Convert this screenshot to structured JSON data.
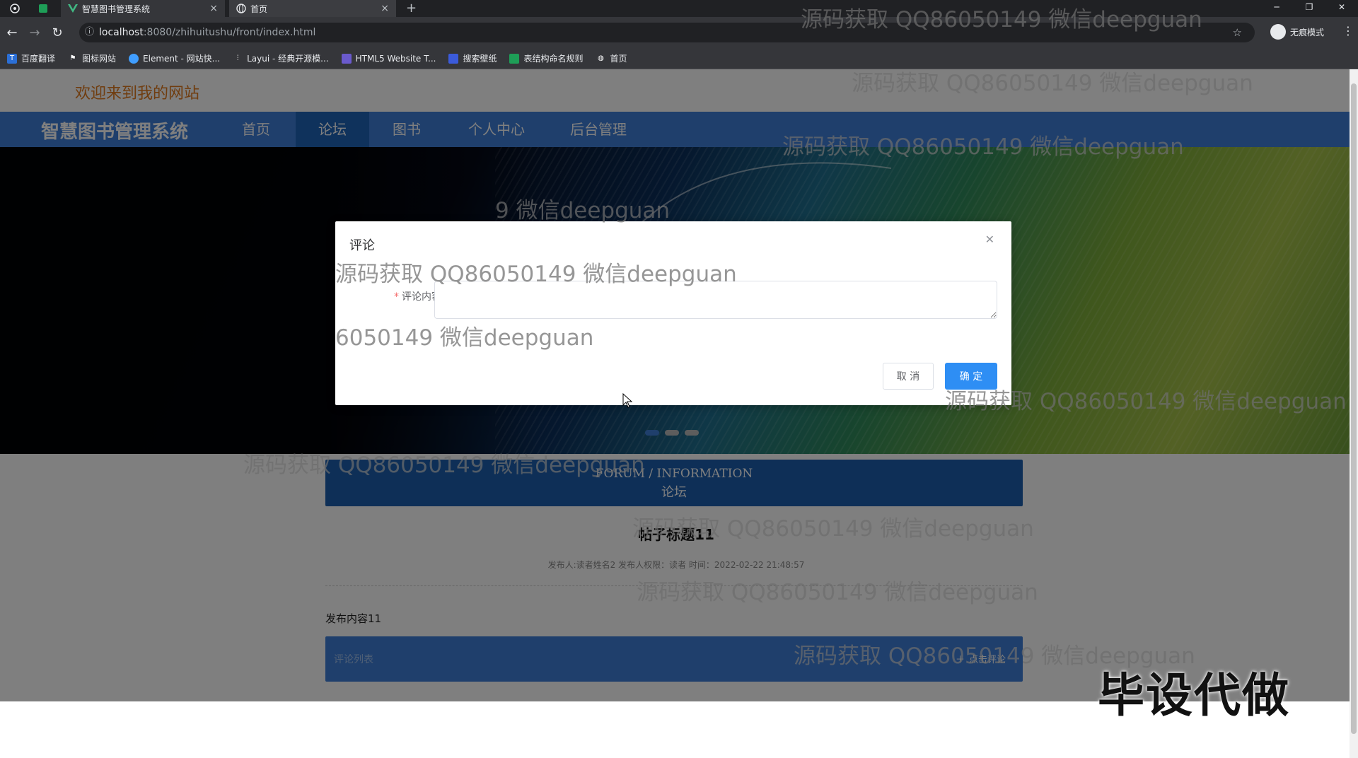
{
  "browser": {
    "tabs": [
      {
        "label": "智慧图书管理系统",
        "close": "×"
      },
      {
        "label": "首页",
        "close": "×"
      }
    ],
    "new_tab": "+",
    "url_host": "localhost",
    "url_path": ":8080/zhihuitushu/front/index.html",
    "incognito_label": "无痕模式",
    "window_buttons": [
      "─",
      "❐",
      "✕"
    ],
    "bookmarks": [
      {
        "label": "百度翻译",
        "icon": "baidu-translate-icon",
        "color": "#2b6fd6"
      },
      {
        "label": "图标网站",
        "icon": "flag-icon",
        "color": "#555555"
      },
      {
        "label": "Element - 网站快...",
        "icon": "element-icon",
        "color": "#409eff"
      },
      {
        "label": "Layui - 经典开源模...",
        "icon": "layui-icon",
        "color": "#777777"
      },
      {
        "label": "HTML5 Website T...",
        "icon": "html5-icon",
        "color": "#6a5acd"
      },
      {
        "label": "搜索壁纸",
        "icon": "wallpaper-icon",
        "color": "#3b5bdb"
      },
      {
        "label": "表结构命名规则",
        "icon": "sheet-icon",
        "color": "#1e9e57"
      },
      {
        "label": "首页",
        "icon": "globe-icon",
        "color": "#888888"
      }
    ]
  },
  "site": {
    "welcome": "欢迎来到我的网站",
    "brand": "智慧图书管理系统",
    "nav": [
      {
        "label": "首页",
        "active": false
      },
      {
        "label": "论坛",
        "active": true
      },
      {
        "label": "图书",
        "active": false
      },
      {
        "label": "个人中心",
        "active": false
      },
      {
        "label": "后台管理",
        "active": false
      }
    ],
    "colors": {
      "nav": "#3f7fd8",
      "nav_active": "#1e64b8",
      "welcome": "#e07a1f",
      "primary_button": "#2e8ef4"
    }
  },
  "forum": {
    "header_en": "FORUM / INFORMATION",
    "header_cn": "论坛",
    "post_title": "帖子标题11",
    "post_meta": "发布人:读者姓名2   发布人权限：读者   时间：2022-02-22 21:48:57",
    "post_body": "发布内容11",
    "comment_label": "评论列表",
    "add_comment": "点击评论"
  },
  "dialog": {
    "title": "评论",
    "field_label": "评论内容",
    "required_mark": "*",
    "field_value": "",
    "cancel": "取 消",
    "confirm": "确 定"
  },
  "watermarks": {
    "text": "源码获取 QQ86050149 微信deepguan",
    "partial_1": "9 微信deepguan",
    "partial_2": "源码获取 QQ86050149 微信deepguan",
    "partial_3": "6050149 微信deepguan",
    "corner": "毕设代做"
  }
}
